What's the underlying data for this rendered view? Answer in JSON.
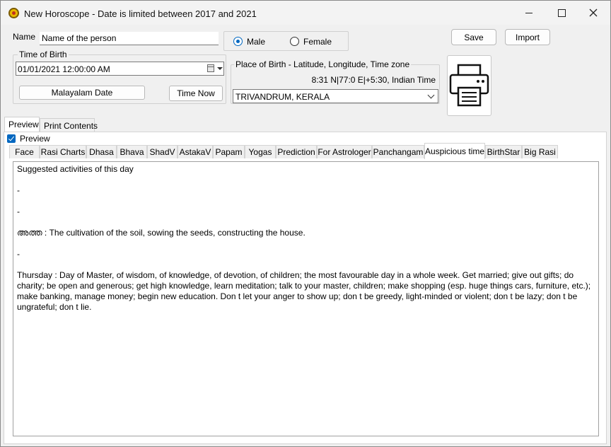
{
  "window": {
    "title": "New Horoscope - Date is limited between 2017 and 2021"
  },
  "form": {
    "name_label": "Name",
    "name_value": "Name of the person",
    "gender_options": [
      "Male",
      "Female"
    ],
    "gender_selected": "Male",
    "save_label": "Save",
    "import_label": "Import",
    "time_of_birth_label": "Time of Birth",
    "datetime_value": "01/01/2021  12:00:00 AM",
    "malayalam_date_label": "Malayalam Date",
    "time_now_label": "Time Now",
    "place_group_label": "Place of Birth - Latitude, Longitude, Time zone",
    "coordinates_text": "8:31 N|77:0 E|+5:30, Indian Time",
    "place_value": "TRIVANDRUM, KERALA"
  },
  "outer_tabs": [
    "Preview",
    "Print Contents"
  ],
  "outer_tab_active": "Preview",
  "preview_checkbox_label": "Preview",
  "inner_tabs": [
    "Face",
    "Rasi Charts",
    "Dhasa",
    "Bhava",
    "ShadV",
    "AstakaV",
    "Papam",
    "Yogas",
    "Prediction",
    "For Astrologer",
    "Panchangam",
    "Auspicious time",
    "BirthStar",
    "Big Rasi"
  ],
  "inner_tab_active": "Auspicious time",
  "content_lines": [
    "Suggested activities of this day",
    "-",
    "-",
    "അത്ത : The cultivation of the soil, sowing the seeds, constructing the house.",
    "-",
    "Thursday : Day of Master, of wisdom, of knowledge, of devotion, of children; the most favourable day in a whole week. Get married; give out gifts; do charity; be open and generous; get high knowledge, learn meditation; talk to your master, children; make shopping (esp. huge things cars, furniture, etc.); make banking, manage money; begin new education. Don t let your anger to show up; don t be greedy, light-minded or violent; don t be lazy; don t be ungrateful; don t lie."
  ],
  "icons": {
    "app": "horoscope-app-icon",
    "print": "printer-icon"
  },
  "colors": {
    "accent": "#0067c0"
  }
}
